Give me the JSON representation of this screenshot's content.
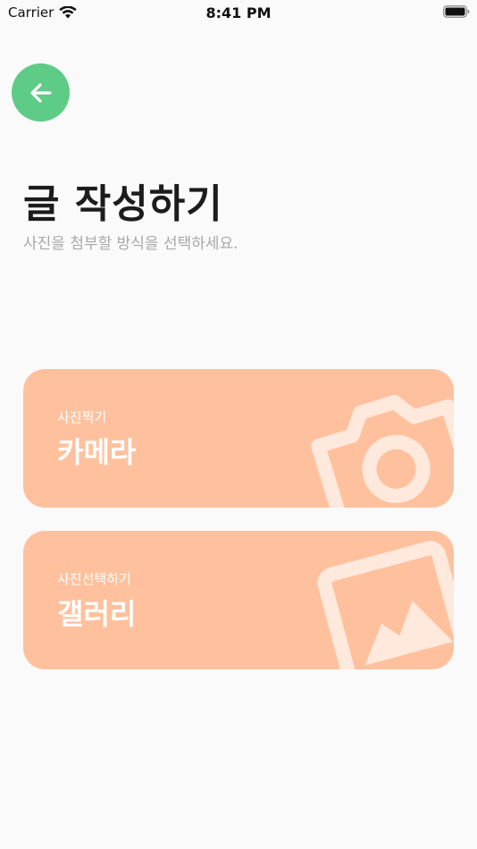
{
  "status_bar": {
    "carrier": "Carrier",
    "time": "8:41 PM"
  },
  "header": {
    "back_icon": "arrow-left-icon",
    "title": "글 작성하기",
    "subtitle": "사진을 첨부할 방식을 선택하세요."
  },
  "options": {
    "camera": {
      "sub_label": "사진찍기",
      "label": "카메라",
      "icon": "camera-icon"
    },
    "gallery": {
      "sub_label": "사진선택하기",
      "label": "갤러리",
      "icon": "image-icon"
    }
  },
  "colors": {
    "accent_green": "#5ecb87",
    "card_peach": "#ffc19d",
    "background": "#fafafa",
    "subtitle_gray": "#a8a8a8"
  }
}
